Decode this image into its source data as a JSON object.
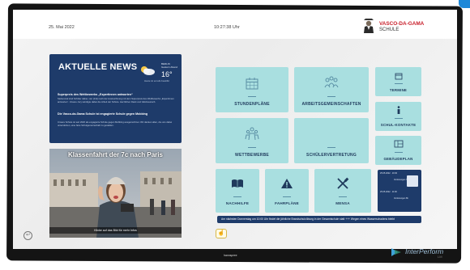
{
  "header": {
    "date": "25. Mai 2022",
    "time": "10:27:38 Uhr",
    "school_line1": "VASCO-DA-GAMA",
    "school_line2": "SCHULE"
  },
  "news": {
    "title": "AKTUELLE NEWS",
    "weather_location": "BERLIN",
    "weather_sub": "Gestern Abend",
    "weather_temp": "16°",
    "weather_caption": "Heute ist es teils bewölkt",
    "headline1": "Superpreis des Wettbewerbs „Expertinnen antworten“",
    "text1": "Siebenmal sind Schüler dabei, vier (3.E) nach der Auszeichnung mit dem Superpreis des Wettbewerbs „Expertinnen antworten“. Unsere Jury würdigte dabei die Arbeit der Schule. Herzlichen Dank und Glückwunsch.",
    "headline2": "Die Vasco-da-Gama Schule ist engagierte Schule gegen Mobbing",
    "text2": "Unsere Schule ist seit 2020 als engagierte Schule gegen Mobbing ausgezeichnet. Wir danken allen, die uns dabei unterstützen, eine faire Schulgemeinschaft zu gestalten."
  },
  "photo": {
    "title": "Klassenfahrt der 7c nach Paris",
    "caption": "Klicke auf das Bild für mehr Infos"
  },
  "tiles": {
    "stundenplaene": "STUNDENPLÄNE",
    "arbeitsgemeinschaften": "ARBEITSGEMEINSCHAFTEN",
    "termine": "TERMINE",
    "wettbewerbe": "WETTBEWERBE",
    "schuelervertretung": "SCHÜLERVERTRETUNG",
    "schulkontakte": "SCHUL-KONTAKTE",
    "gebaeudeplan": "GEBÄUDEPLAN",
    "nachhilfe": "NACHHILFE",
    "fahrplaene": "FAHRPLÄNE",
    "mensa": "MENSA"
  },
  "embedded": {
    "row1_time": "25.05.2022 · 10:30",
    "row1_label": "Vertretungen 7b",
    "row2_time": "25.05.2022 · 11:00",
    "row2_label": "Vertretungen 8b"
  },
  "ticker": {
    "text": "Am nächsten Donnerstag um 10:00 Uhr findet die jährliche Brandschutzübung in der Gesamtschule statt +++ Wegen eines Wasserschadens bleibt"
  },
  "footer": {
    "back_icon": "↩",
    "hand_icon": "☝",
    "brand": "hannspree",
    "watermark": "InterPerform",
    "watermark_suffix": "LM"
  },
  "colors": {
    "navy": "#1e3b6a",
    "tile": "#a9dfe0",
    "accent_red": "#c81e2a"
  }
}
